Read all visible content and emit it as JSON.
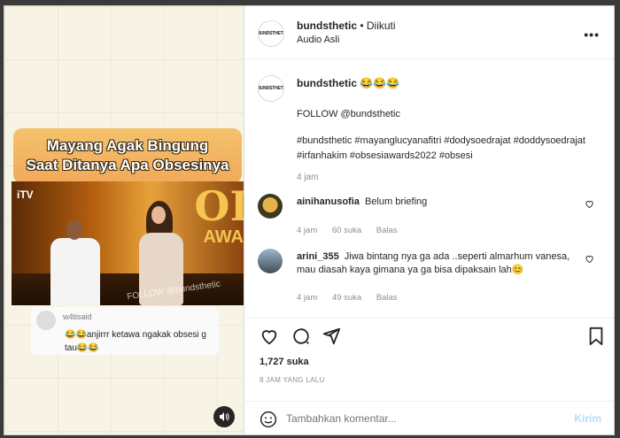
{
  "media": {
    "banner_line1": "Mayang Agak Bingung",
    "banner_line2": "Saat Ditanya Apa Obsesinya",
    "tv_logo": "iTV",
    "stage_text": "OI",
    "stage_text2": "AWA",
    "watermark": "FOLLOW @bundsthetic",
    "comment_user": "w4tisaid",
    "comment_text": "😂😂anjirrr ketawa ngakak obsesi g tau😂😂",
    "volume_icon": "speaker-icon"
  },
  "header": {
    "avatar_text": "#BUNDSTHETIC",
    "username": "bundsthetic",
    "follow_status": "• Diikuti",
    "audio": "Audio Asli",
    "more_icon": "•••"
  },
  "caption": {
    "avatar_text": "#BUNDSTHETIC",
    "username": "bundsthetic",
    "emoji": "😂😂😂",
    "line1": "FOLLOW @bundsthetic",
    "tags": "#bundsthetic #mayanglucyanafitri #dodysoedrajat #doddysoedrajat #irfanhakim #obsesiawards2022 #obsesi",
    "time": "4 jam"
  },
  "comments": [
    {
      "username": "ainihanusofia",
      "text": "Belum briefing",
      "time": "4 jam",
      "likes": "60 suka",
      "reply": "Balas"
    },
    {
      "username": "arini_355",
      "text": "Jiwa bintang nya ga ada ..seperti almarhum vanesa, mau diasah kaya gimana ya ga bisa dipaksain lah😊",
      "time": "4 jam",
      "likes": "49 suka",
      "reply": "Balas"
    }
  ],
  "actions": {
    "likes": "1,727 suka",
    "date": "8 JAM YANG LALU"
  },
  "add_comment": {
    "placeholder": "Tambahkan komentar...",
    "send": "Kirim"
  }
}
